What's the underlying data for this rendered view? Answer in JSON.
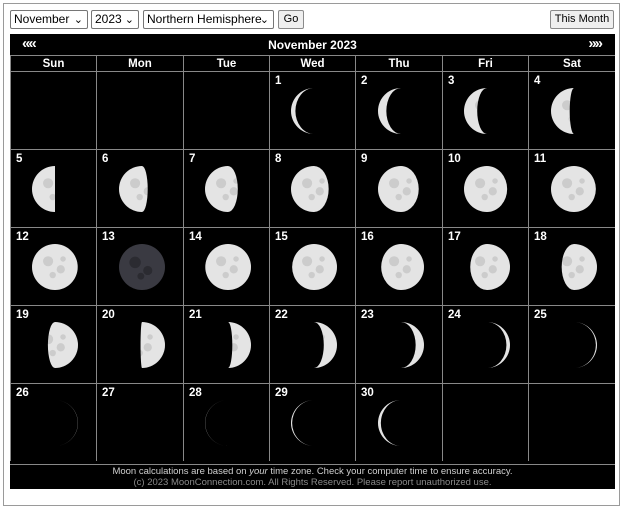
{
  "controls": {
    "month": "November",
    "year": "2023",
    "hemisphere": "Northern Hemisphere",
    "go_label": "Go",
    "this_month_label": "This Month"
  },
  "calendar": {
    "title": "November 2023",
    "prev_label": "««",
    "next_label": "»»",
    "weekdays": [
      "Sun",
      "Mon",
      "Tue",
      "Wed",
      "Thu",
      "Fri",
      "Sat"
    ],
    "first_weekday_index": 3,
    "days": [
      {
        "day": "1",
        "phase": 0.6
      },
      {
        "day": "2",
        "phase": 0.64
      },
      {
        "day": "3",
        "phase": 0.68
      },
      {
        "day": "4",
        "phase": 0.72
      },
      {
        "day": "5",
        "phase": 0.75
      },
      {
        "day": "6",
        "phase": 0.79
      },
      {
        "day": "7",
        "phase": 0.82
      },
      {
        "day": "8",
        "phase": 0.86
      },
      {
        "day": "9",
        "phase": 0.89
      },
      {
        "day": "10",
        "phase": 0.92
      },
      {
        "day": "11",
        "phase": 0.95
      },
      {
        "day": "12",
        "phase": 0.975
      },
      {
        "day": "13",
        "phase": 0.0
      },
      {
        "day": "14",
        "phase": 0.025
      },
      {
        "day": "15",
        "phase": 0.05
      },
      {
        "day": "16",
        "phase": 0.085
      },
      {
        "day": "17",
        "phase": 0.12
      },
      {
        "day": "18",
        "phase": 0.16
      },
      {
        "day": "19",
        "phase": 0.2
      },
      {
        "day": "20",
        "phase": 0.24
      },
      {
        "day": "21",
        "phase": 0.28
      },
      {
        "day": "22",
        "phase": 0.32
      },
      {
        "day": "23",
        "phase": 0.36
      },
      {
        "day": "24",
        "phase": 0.41
      },
      {
        "day": "25",
        "phase": 0.45
      },
      {
        "day": "26",
        "phase": 0.48
      },
      {
        "day": "27",
        "phase": 0.5
      },
      {
        "day": "28",
        "phase": 0.52
      },
      {
        "day": "29",
        "phase": 0.55
      },
      {
        "day": "30",
        "phase": 0.58
      }
    ],
    "footer_line1_pre": "Moon calculations are based on ",
    "footer_line1_em": "your",
    "footer_line1_post": " time zone. Check your computer time to ensure accuracy.",
    "footer_line2": "(c) 2023 MoonConnection.com. All Rights Reserved. Please report unauthorized use."
  },
  "colors": {
    "background": "#000000",
    "grid_line": "#888888",
    "moon_lit": "#e4e4e4",
    "moon_dark": "#2a2a32"
  }
}
